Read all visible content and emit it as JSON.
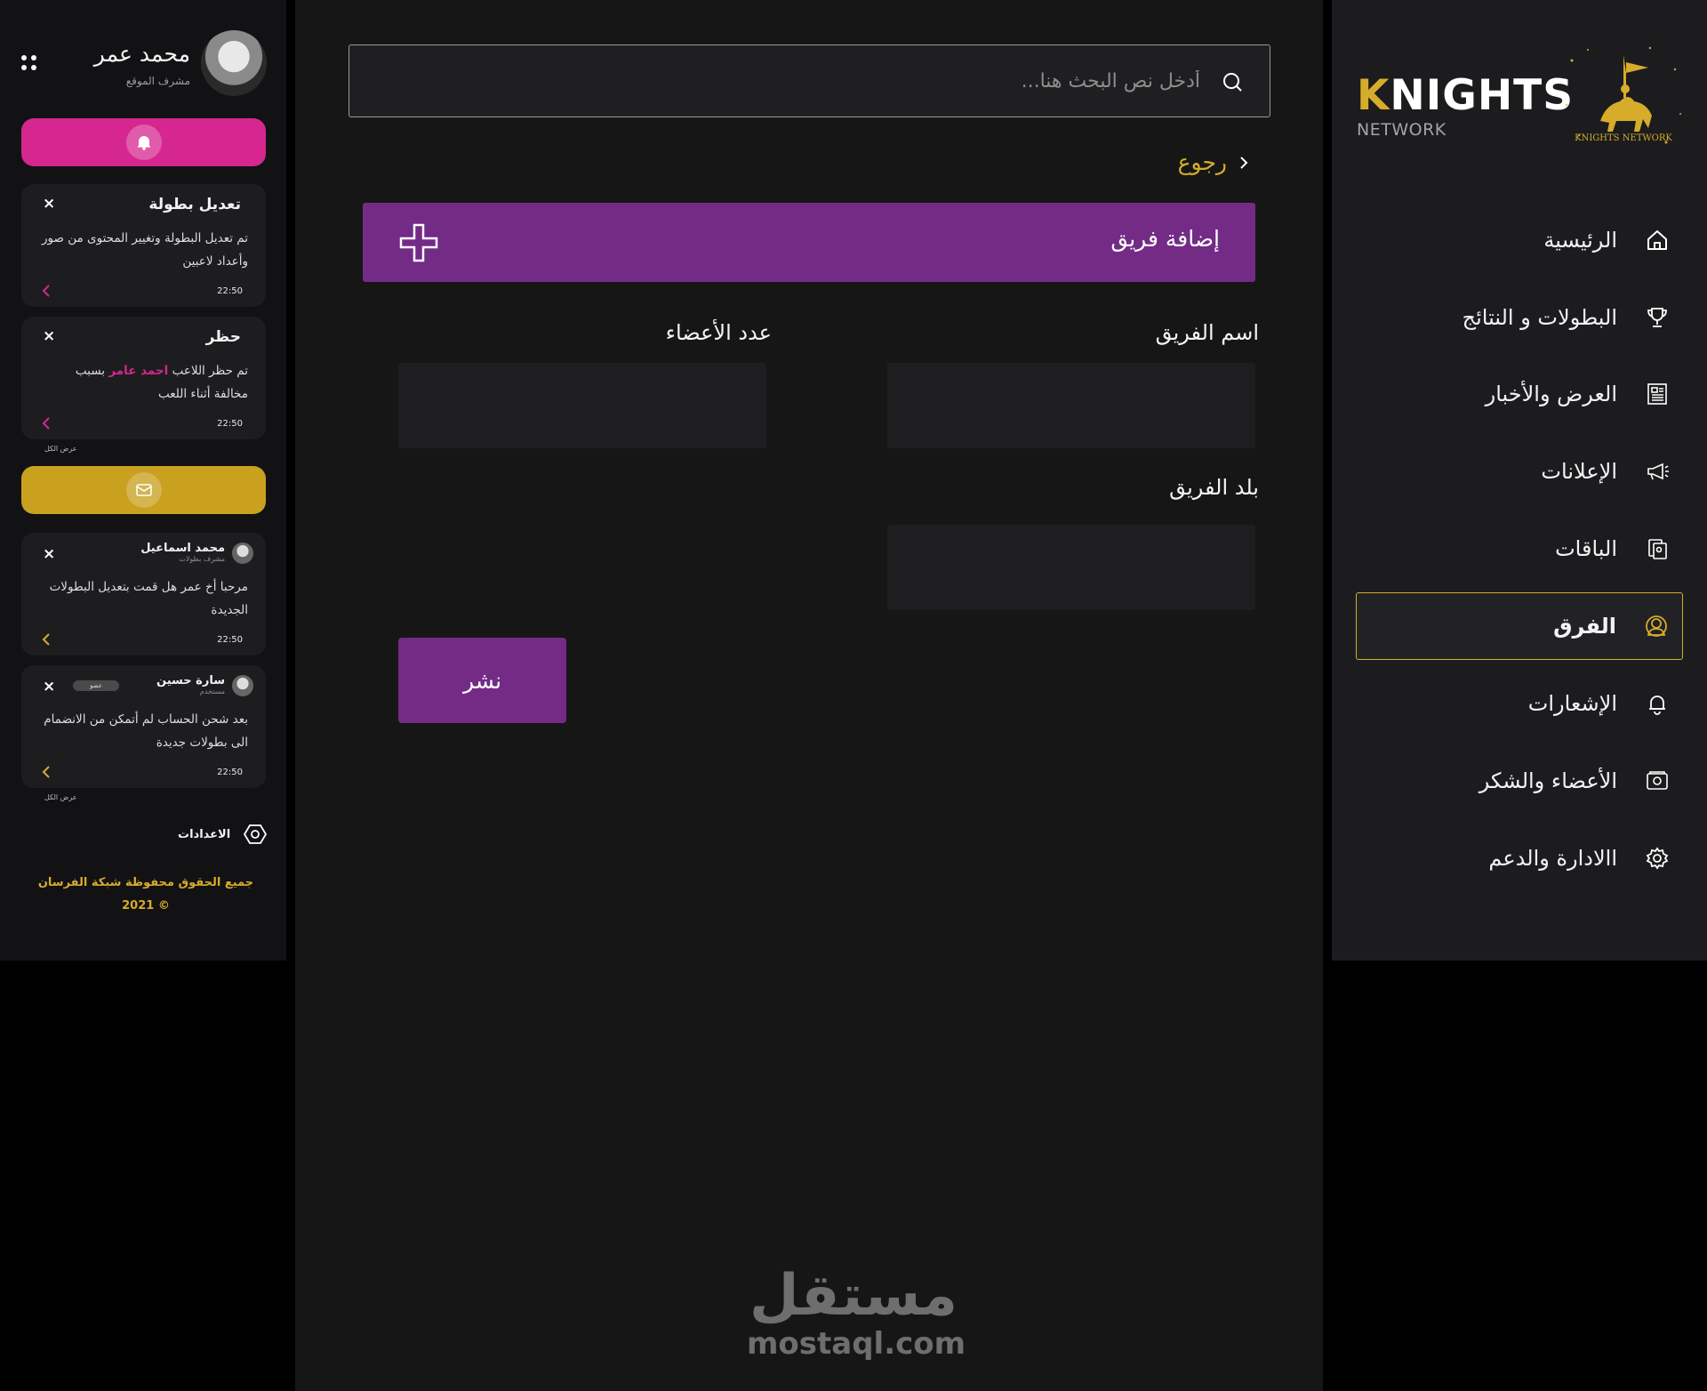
{
  "brand": {
    "name_first_letter": "K",
    "name_rest": "NIGHTS",
    "subtitle": "NETWORK",
    "emblem_text": "KNIGHTS NETWORK",
    "accent": "#d6ac2a",
    "purple": "#732b86",
    "pink": "#d6268f"
  },
  "nav": {
    "items": [
      {
        "label": "الرئيسية",
        "icon": "home-icon"
      },
      {
        "label": "البطولات و النتائج",
        "icon": "trophy-icon"
      },
      {
        "label": "العرض والأخبار",
        "icon": "newspaper-icon"
      },
      {
        "label": "الإعلانات",
        "icon": "megaphone-icon"
      },
      {
        "label": "الباقات",
        "icon": "package-icon"
      },
      {
        "label": "الفرق",
        "icon": "team-icon",
        "active": true
      },
      {
        "label": "الإشعارات",
        "icon": "bell-icon"
      },
      {
        "label": "الأعضاء والشكر",
        "icon": "members-icon"
      },
      {
        "label": "االادارة والدعم",
        "icon": "gear-icon"
      }
    ]
  },
  "search": {
    "placeholder": "أدخل نص البحث هنا..."
  },
  "back": {
    "label": "رجوع"
  },
  "form": {
    "banner_title": "إضافة فريق",
    "team_name_label": "اسم الفريق",
    "members_count_label": "عدد الأعضاء",
    "team_country_label": "بلد الفريق",
    "team_name_value": "",
    "members_count_value": "",
    "team_country_value": "",
    "publish_label": "نشر"
  },
  "user": {
    "name": "محمد عمر",
    "role": "مشرف الموقع"
  },
  "notifications": [
    {
      "title": "تعديل بطولة",
      "body": "تم تعديل البطولة وتغيير المحتوى من صور وأعداد لاعبين",
      "time": "22:50"
    },
    {
      "title": "حظر",
      "body_before": "تم حظر اللاعب ",
      "body_highlight": "احمد عامر",
      "body_after": " بسبب مخالفة أثناء اللعب",
      "time": "22:50"
    }
  ],
  "messages": [
    {
      "name": "محمد اسماعيل",
      "sub": "مشرف بطولات",
      "body": "مرحبا أخ عمر هل قمت بتعديل البطولات الجديدة",
      "time": "22:50"
    },
    {
      "name": "سارة حسين",
      "sub": "مستخدم",
      "tag": "عضو",
      "body": "بعد شحن الحساب لم أتمكن من الانضمام الى بطولات جديدة",
      "time": "22:50"
    }
  ],
  "view_all": "عرض الكل",
  "close_glyph": "×",
  "settings": {
    "label": "الاعدادات"
  },
  "copyright": {
    "line1": "جميع الحقوق محفوظة شبكة الفرسان",
    "line2": "© 2021"
  },
  "watermark": {
    "arabic": "مستقل",
    "latin": "mostaql.com"
  }
}
